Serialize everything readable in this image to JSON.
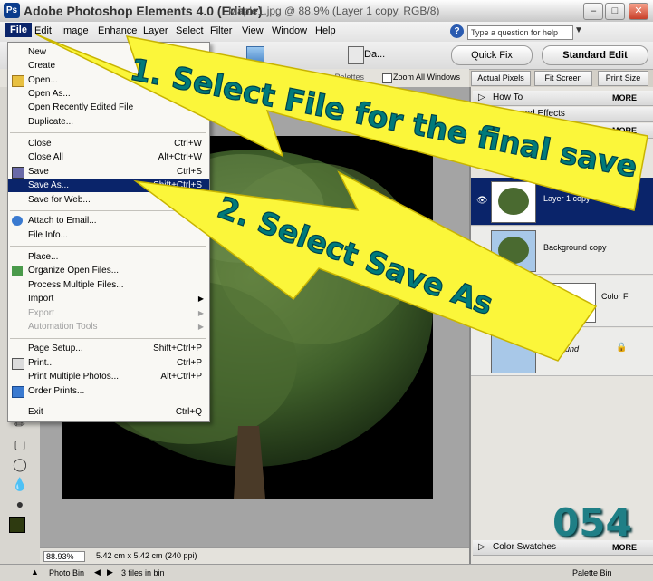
{
  "titlebar": {
    "app_name": "Adobe Photoshop Elements 4.0 (Editor)",
    "document": "Maple1.jpg @ 88.9% (Layer 1 copy, RGB/8)",
    "logo": "Ps"
  },
  "menubar": {
    "items": [
      "File",
      "Edit",
      "Image",
      "Enhance",
      "Layer",
      "Select",
      "Filter",
      "View",
      "Window",
      "Help"
    ],
    "help_placeholder": "Type a question for help"
  },
  "toolbar": {
    "partial_label": "Da...",
    "quick_fix": "Quick Fix",
    "standard_edit": "Standard Edit"
  },
  "options": {
    "palettes_partial": "ore Palettes",
    "zoom_all": "Zoom All Windows",
    "actual_pixels": "Actual Pixels",
    "fit_screen": "Fit Screen",
    "print_size": "Print Size"
  },
  "file_menu": {
    "items": [
      {
        "label": "New",
        "shortcut": "",
        "submenu": true,
        "disabled": false,
        "highlighted": false
      },
      {
        "label": "Create",
        "shortcut": "",
        "submenu": true,
        "disabled": false,
        "highlighted": false
      },
      {
        "label": "Open...",
        "shortcut": "",
        "submenu": false,
        "disabled": false,
        "highlighted": false
      },
      {
        "label": "Open As...",
        "shortcut": "Alt+Ct",
        "submenu": false,
        "disabled": false,
        "highlighted": false
      },
      {
        "label": "Open Recently Edited File",
        "shortcut": "",
        "submenu": true,
        "disabled": false,
        "highlighted": false
      },
      {
        "label": "Duplicate...",
        "shortcut": "",
        "submenu": false,
        "disabled": false,
        "highlighted": false
      },
      {
        "label": "Close",
        "shortcut": "Ctrl+W",
        "submenu": false,
        "disabled": false,
        "highlighted": false
      },
      {
        "label": "Close All",
        "shortcut": "Alt+Ctrl+W",
        "submenu": false,
        "disabled": false,
        "highlighted": false
      },
      {
        "label": "Save",
        "shortcut": "Ctrl+S",
        "submenu": false,
        "disabled": false,
        "highlighted": false
      },
      {
        "label": "Save As...",
        "shortcut": "Shift+Ctrl+S",
        "submenu": false,
        "disabled": false,
        "highlighted": true
      },
      {
        "label": "Save for Web...",
        "shortcut": "Alt+S",
        "submenu": false,
        "disabled": false,
        "highlighted": false
      },
      {
        "label": "Attach to Email...",
        "shortcut": "",
        "submenu": false,
        "disabled": false,
        "highlighted": false
      },
      {
        "label": "File Info...",
        "shortcut": "",
        "submenu": false,
        "disabled": false,
        "highlighted": false
      },
      {
        "label": "Place...",
        "shortcut": "",
        "submenu": false,
        "disabled": false,
        "highlighted": false
      },
      {
        "label": "Organize Open Files...",
        "shortcut": "",
        "submenu": false,
        "disabled": false,
        "highlighted": false
      },
      {
        "label": "Process Multiple Files...",
        "shortcut": "",
        "submenu": false,
        "disabled": false,
        "highlighted": false
      },
      {
        "label": "Import",
        "shortcut": "",
        "submenu": true,
        "disabled": false,
        "highlighted": false
      },
      {
        "label": "Export",
        "shortcut": "",
        "submenu": true,
        "disabled": true,
        "highlighted": false
      },
      {
        "label": "Automation Tools",
        "shortcut": "",
        "submenu": true,
        "disabled": true,
        "highlighted": false
      },
      {
        "label": "Page Setup...",
        "shortcut": "Shift+Ctrl+P",
        "submenu": false,
        "disabled": false,
        "highlighted": false
      },
      {
        "label": "Print...",
        "shortcut": "Ctrl+P",
        "submenu": false,
        "disabled": false,
        "highlighted": false
      },
      {
        "label": "Print Multiple Photos...",
        "shortcut": "Alt+Ctrl+P",
        "submenu": false,
        "disabled": false,
        "highlighted": false
      },
      {
        "label": "Order Prints...",
        "shortcut": "",
        "submenu": false,
        "disabled": false,
        "highlighted": false
      },
      {
        "label": "Exit",
        "shortcut": "Ctrl+Q",
        "submenu": false,
        "disabled": false,
        "highlighted": false
      }
    ]
  },
  "palette": {
    "how_to": "How To",
    "styles_effects": "Styles and Effects",
    "more": "MORE",
    "layers": [
      "Layer 1 copy",
      "Background copy",
      "Color F",
      "und"
    ],
    "color_swatches": "Color Swatches"
  },
  "status": {
    "zoom": "88.93%",
    "doc_size": "5.42 cm x 5.42 cm (240 ppi)"
  },
  "bottom": {
    "photo_bin": "Photo Bin",
    "files_in_bin": "3 files in bin",
    "palette_bin": "Palette Bin"
  },
  "annotations": {
    "step1": "1. Select File for the final save",
    "step2": "2. Select Save As",
    "frame_number": "054"
  }
}
